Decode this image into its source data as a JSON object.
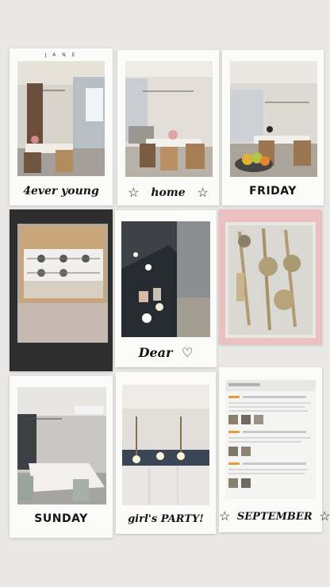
{
  "polaroid_brand": "J A N E",
  "captions": {
    "c1": "4ever young",
    "c2": "home",
    "c3": "FRIDAY",
    "c5": "Dear",
    "c7": "SUNDAY",
    "c8": "girl's PARTY!",
    "c9": "SEPTEMBER"
  },
  "decorations": {
    "star": "☆",
    "heart": "♡"
  },
  "icons": [
    "star-outline-icon",
    "heart-outline-icon"
  ],
  "colors": {
    "background": "#e9e8e6",
    "polaroid_white": "#fbfbfa",
    "polaroid_black": "#2e2e2e",
    "polaroid_pink": "#ecc0c0"
  }
}
